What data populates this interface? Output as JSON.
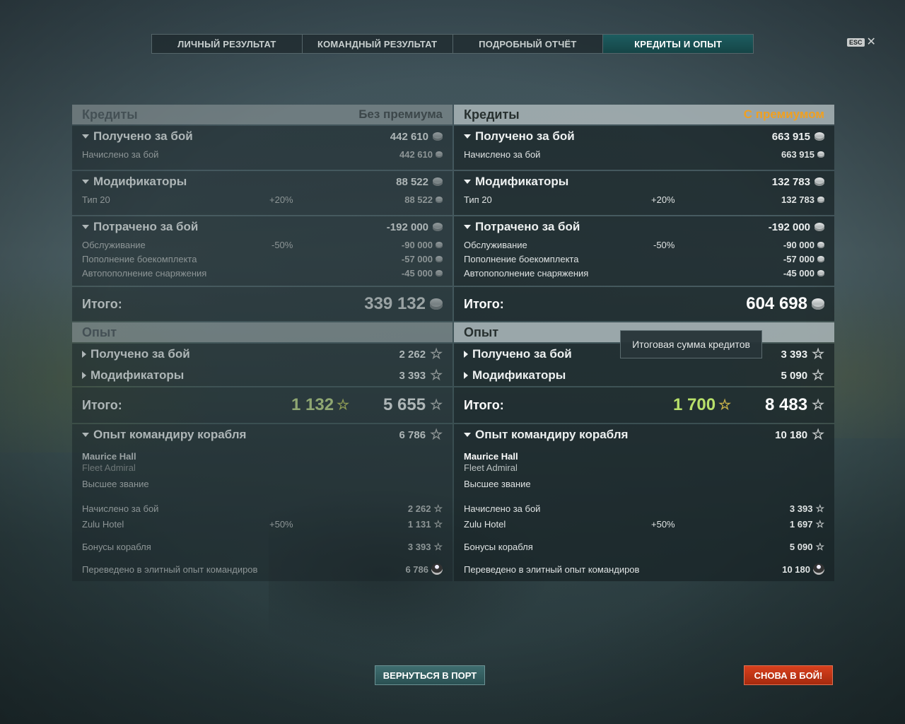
{
  "tabs": [
    {
      "label": "ЛИЧНЫЙ РЕЗУЛЬТАТ"
    },
    {
      "label": "КОМАНДНЫЙ РЕЗУЛЬТАТ"
    },
    {
      "label": "ПОДРОБНЫЙ ОТЧЁТ"
    },
    {
      "label": "КРЕДИТЫ И ОПЫТ",
      "active": true
    }
  ],
  "esc_label": "ESC",
  "close_glyph": "✕",
  "tooltip": "Итоговая сумма кредитов",
  "buttons": {
    "port": "ВЕРНУТЬСЯ В ПОРТ",
    "battle": "СНОВА В БОЙ!"
  },
  "labels": {
    "credits": "Кредиты",
    "earned": "Получено за бой",
    "accrued": "Начислено за бой",
    "modifiers": "Модификаторы",
    "type20": "Тип 20",
    "spent": "Потрачено за бой",
    "service": "Обслуживание",
    "ammo": "Пополнение боекомплекта",
    "consumables": "Автопополнение снаряжения",
    "total": "Итого:",
    "xp": "Опыт",
    "cmdr_xp": "Опыт командиру корабля",
    "cmdr_name": "Maurice Hall",
    "cmdr_rank": "Fleet Admiral",
    "cmdr_status": "Высшее звание",
    "zulu_hotel": "Zulu Hotel",
    "ship_bonus": "Бонусы корабля",
    "elite_xp": "Переведено в элитный опыт командиров"
  },
  "left": {
    "subtitle": "Без премиума",
    "earned": "442 610",
    "accrued": "442 610",
    "modifiers": "88 522",
    "type20_pct": "+20%",
    "type20": "88 522",
    "spent": "-192 000",
    "service_pct": "-50%",
    "service": "-90 000",
    "ammo": "-57 000",
    "consumables": "-45 000",
    "total_credits": "339 132",
    "xp_earned": "2 262",
    "xp_modifiers": "3 393",
    "xp_total_prem": "1 132",
    "xp_total": "5 655",
    "cmdr_xp": "6 786",
    "cmdr_accrued": "2 262",
    "zulu_pct": "+50%",
    "zulu": "1 131",
    "ship_bonus": "3 393",
    "elite_xp": "6 786"
  },
  "right": {
    "subtitle": "С премиумом",
    "earned": "663 915",
    "accrued": "663 915",
    "modifiers": "132 783",
    "type20_pct": "+20%",
    "type20": "132 783",
    "spent": "-192 000",
    "service_pct": "-50%",
    "service": "-90 000",
    "ammo": "-57 000",
    "consumables": "-45 000",
    "total_credits": "604 698",
    "xp_earned": "3 393",
    "xp_modifiers": "5 090",
    "xp_total_prem": "1 700",
    "xp_total": "8 483",
    "cmdr_xp": "10 180",
    "cmdr_accrued": "3 393",
    "zulu_pct": "+50%",
    "zulu": "1 697",
    "ship_bonus": "5 090",
    "elite_xp": "10 180"
  },
  "icons": {
    "credits": "coin-icon",
    "xp": "star-icon",
    "elite": "elite-commander-icon"
  },
  "colors": {
    "premium_accent": "#f0a020",
    "premium_xp": "#b8e06a",
    "battle_button": "#d8401d",
    "active_tab": "#1d5d60"
  }
}
